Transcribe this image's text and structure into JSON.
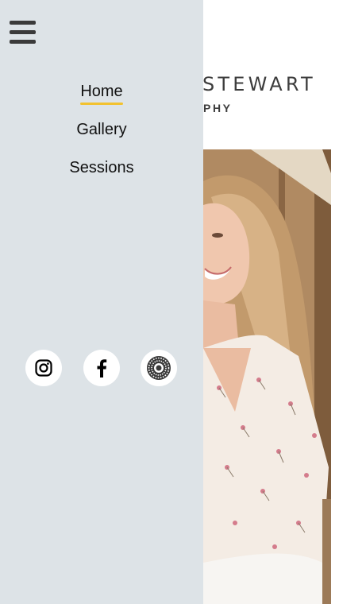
{
  "brand": {
    "name": "STEWART",
    "subtitle": "PHY"
  },
  "menu": {
    "toggle_icon": "hamburger-menu-icon",
    "items": [
      {
        "label": "Home",
        "active": true
      },
      {
        "label": "Gallery",
        "active": false
      },
      {
        "label": "Sessions",
        "active": false
      }
    ],
    "accent_color": "#f2c230",
    "background_color": "#dde3e7"
  },
  "social": [
    {
      "icon": "instagram-icon"
    },
    {
      "icon": "facebook-icon"
    },
    {
      "icon": "vsco-icon"
    }
  ],
  "photo": {
    "icon": "portrait-photo"
  }
}
